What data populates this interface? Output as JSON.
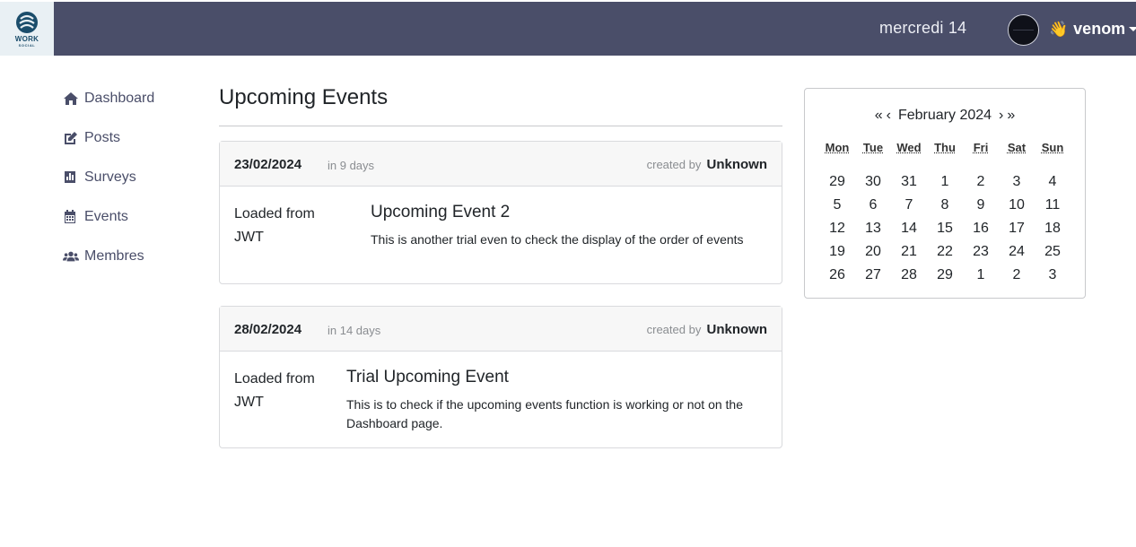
{
  "header": {
    "logo_line1": "WORK",
    "logo_line2": "SOCIAL",
    "date_text": "mercredi 14",
    "wave_emoji": "👋",
    "username": "venom"
  },
  "sidebar": {
    "items": [
      {
        "label": "Dashboard",
        "icon": "home-icon"
      },
      {
        "label": "Posts",
        "icon": "edit-icon"
      },
      {
        "label": "Surveys",
        "icon": "chart-icon"
      },
      {
        "label": "Events",
        "icon": "calendar-icon"
      },
      {
        "label": "Membres",
        "icon": "users-icon"
      }
    ]
  },
  "main": {
    "title": "Upcoming Events",
    "events": [
      {
        "date": "23/02/2024",
        "relative": "in 9 days",
        "created_by_label": "created by",
        "author": "Unknown",
        "source": "Loaded from JWT",
        "title": "Upcoming Event 2",
        "description": "This is another trial even to check the display of the order of events"
      },
      {
        "date": "28/02/2024",
        "relative": "in 14 days",
        "created_by_label": "created by",
        "author": "Unknown",
        "source": "Loaded from JWT",
        "title": "Trial Upcoming Event",
        "description": "This is to check if the upcoming events function is working or not on the Dashboard page."
      }
    ]
  },
  "calendar": {
    "prev_year": "«",
    "prev_month": "‹",
    "label": "February 2024",
    "next_month": "›",
    "next_year": "»",
    "weekdays": [
      "Mon",
      "Tue",
      "Wed",
      "Thu",
      "Fri",
      "Sat",
      "Sun"
    ],
    "weeks": [
      [
        "29",
        "30",
        "31",
        "1",
        "2",
        "3",
        "4"
      ],
      [
        "5",
        "6",
        "7",
        "8",
        "9",
        "10",
        "11"
      ],
      [
        "12",
        "13",
        "14",
        "15",
        "16",
        "17",
        "18"
      ],
      [
        "19",
        "20",
        "21",
        "22",
        "23",
        "24",
        "25"
      ],
      [
        "26",
        "27",
        "28",
        "29",
        "1",
        "2",
        "3"
      ]
    ]
  },
  "colors": {
    "topbar": "#4a4e69",
    "nav_text": "#4a4e69",
    "card_header_bg": "#f7f7f7"
  }
}
